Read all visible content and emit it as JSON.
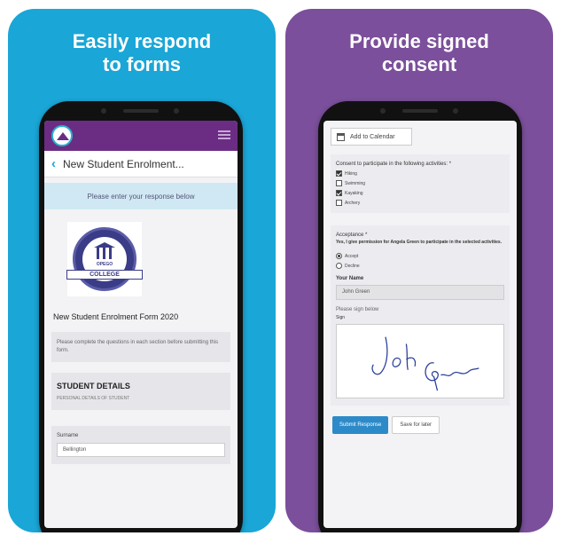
{
  "left_card": {
    "headline": [
      "Easily respond",
      "to forms"
    ],
    "header_title": "New Student Enrolment...",
    "notice": "Please enter your response below",
    "logo_text_top": "OPEGO",
    "logo_text_banner": "COLLEGE",
    "form_title": "New Student Enrolment Form 2020",
    "intro": "Please complete the questions in each section before submitting this form.",
    "section_title": "STUDENT DETAILS",
    "section_subtitle": "PERSONAL DETAILS OF STUDENT",
    "field_label": "Surname",
    "field_value": "Bellington"
  },
  "right_card": {
    "headline": [
      "Provide signed",
      "consent"
    ],
    "calendar_button": "Add to Calendar",
    "consent_question": "Consent to participate in the following activities: *",
    "activities": [
      {
        "label": "Hiking",
        "checked": true
      },
      {
        "label": "Swimming",
        "checked": false
      },
      {
        "label": "Kayaking",
        "checked": true
      },
      {
        "label": "Archery",
        "checked": false
      }
    ],
    "acceptance_label": "Acceptance *",
    "acceptance_text": "Yes, I give permission for Angela Green to participate in the selected activities.",
    "options": [
      {
        "label": "Accept",
        "selected": true
      },
      {
        "label": "Decline",
        "selected": false
      }
    ],
    "name_label": "Your Name",
    "name_value": "John Green",
    "signature_label": "Please sign below",
    "signature_hint": "Sign",
    "submit_button": "Submit Response",
    "save_button": "Save for later"
  },
  "colors": {
    "left_bg": "#1aa6d6",
    "right_bg": "#7b4f9b",
    "appbar": "#6b2d84",
    "submit": "#2d8ac8"
  }
}
